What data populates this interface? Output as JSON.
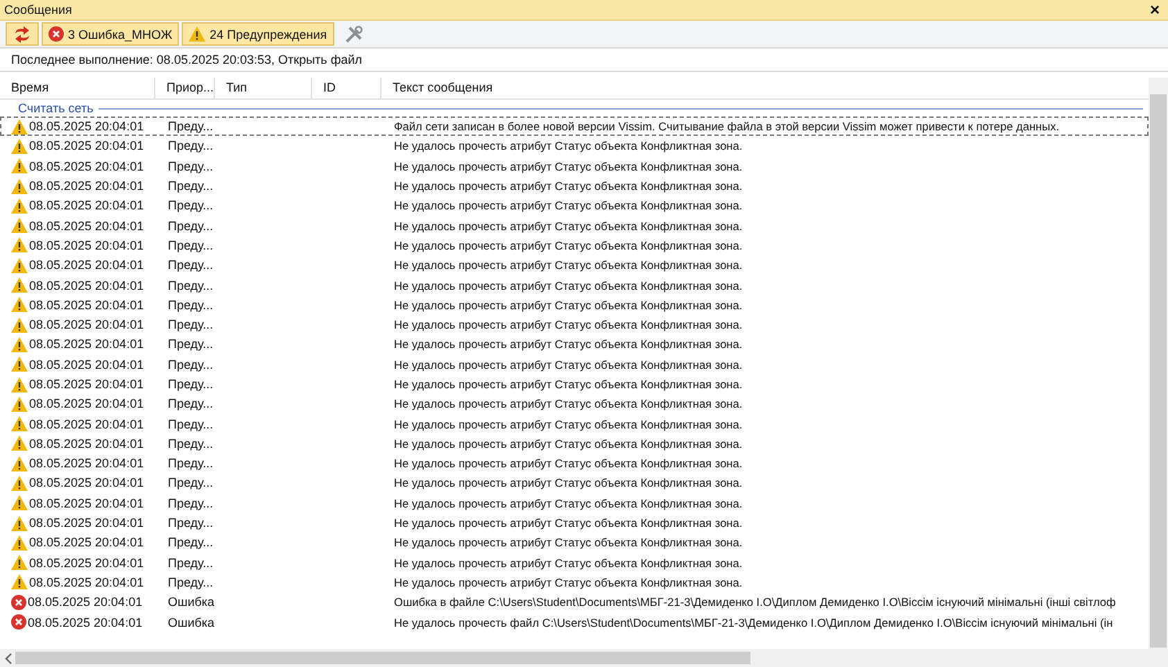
{
  "window": {
    "title": "Сообщения",
    "close": "×"
  },
  "toolbar": [
    {
      "kind": "refresh",
      "selected": true
    },
    {
      "kind": "errors",
      "label": "3 Ошибка_МНОЖ",
      "selected": true
    },
    {
      "kind": "warnings",
      "label": "24 Предупреждения",
      "selected": true
    },
    {
      "kind": "tools",
      "selected": false
    }
  ],
  "last_run": "Последнее выполнение: 08.05.2025 20:03:53, Открыть файл",
  "table": {
    "columns": [
      "Время",
      "Приор...",
      "Тип",
      "ID",
      "Текст сообщения"
    ],
    "group": "Считать сеть",
    "rows": [
      {
        "kind": "warning",
        "focused": true,
        "time": "08.05.2025 20:04:01",
        "priority": "Преду...",
        "text": "Файл сети записан в более новой версии Vissim. Считывание файла в этой версии Vissim может привести к потере данных."
      },
      {
        "kind": "warning",
        "focused": false,
        "time": "08.05.2025 20:04:01",
        "priority": "Преду...",
        "text": "Не удалось прочесть атрибут Статус объекта Конфликтная зона."
      },
      {
        "kind": "warning",
        "focused": false,
        "time": "08.05.2025 20:04:01",
        "priority": "Преду...",
        "text": "Не удалось прочесть атрибут Статус объекта Конфликтная зона."
      },
      {
        "kind": "warning",
        "focused": false,
        "time": "08.05.2025 20:04:01",
        "priority": "Преду...",
        "text": "Не удалось прочесть атрибут Статус объекта Конфликтная зона."
      },
      {
        "kind": "warning",
        "focused": false,
        "time": "08.05.2025 20:04:01",
        "priority": "Преду...",
        "text": "Не удалось прочесть атрибут Статус объекта Конфликтная зона."
      },
      {
        "kind": "warning",
        "focused": false,
        "time": "08.05.2025 20:04:01",
        "priority": "Преду...",
        "text": "Не удалось прочесть атрибут Статус объекта Конфликтная зона."
      },
      {
        "kind": "warning",
        "focused": false,
        "time": "08.05.2025 20:04:01",
        "priority": "Преду...",
        "text": "Не удалось прочесть атрибут Статус объекта Конфликтная зона."
      },
      {
        "kind": "warning",
        "focused": false,
        "time": "08.05.2025 20:04:01",
        "priority": "Преду...",
        "text": "Не удалось прочесть атрибут Статус объекта Конфликтная зона."
      },
      {
        "kind": "warning",
        "focused": false,
        "time": "08.05.2025 20:04:01",
        "priority": "Преду...",
        "text": "Не удалось прочесть атрибут Статус объекта Конфликтная зона."
      },
      {
        "kind": "warning",
        "focused": false,
        "time": "08.05.2025 20:04:01",
        "priority": "Преду...",
        "text": "Не удалось прочесть атрибут Статус объекта Конфликтная зона."
      },
      {
        "kind": "warning",
        "focused": false,
        "time": "08.05.2025 20:04:01",
        "priority": "Преду...",
        "text": "Не удалось прочесть атрибут Статус объекта Конфликтная зона."
      },
      {
        "kind": "warning",
        "focused": false,
        "time": "08.05.2025 20:04:01",
        "priority": "Преду...",
        "text": "Не удалось прочесть атрибут Статус объекта Конфликтная зона."
      },
      {
        "kind": "warning",
        "focused": false,
        "time": "08.05.2025 20:04:01",
        "priority": "Преду...",
        "text": "Не удалось прочесть атрибут Статус объекта Конфликтная зона."
      },
      {
        "kind": "warning",
        "focused": false,
        "time": "08.05.2025 20:04:01",
        "priority": "Преду...",
        "text": "Не удалось прочесть атрибут Статус объекта Конфликтная зона."
      },
      {
        "kind": "warning",
        "focused": false,
        "time": "08.05.2025 20:04:01",
        "priority": "Преду...",
        "text": "Не удалось прочесть атрибут Статус объекта Конфликтная зона."
      },
      {
        "kind": "warning",
        "focused": false,
        "time": "08.05.2025 20:04:01",
        "priority": "Преду...",
        "text": "Не удалось прочесть атрибут Статус объекта Конфликтная зона."
      },
      {
        "kind": "warning",
        "focused": false,
        "time": "08.05.2025 20:04:01",
        "priority": "Преду...",
        "text": "Не удалось прочесть атрибут Статус объекта Конфликтная зона."
      },
      {
        "kind": "warning",
        "focused": false,
        "time": "08.05.2025 20:04:01",
        "priority": "Преду...",
        "text": "Не удалось прочесть атрибут Статус объекта Конфликтная зона."
      },
      {
        "kind": "warning",
        "focused": false,
        "time": "08.05.2025 20:04:01",
        "priority": "Преду...",
        "text": "Не удалось прочесть атрибут Статус объекта Конфликтная зона."
      },
      {
        "kind": "warning",
        "focused": false,
        "time": "08.05.2025 20:04:01",
        "priority": "Преду...",
        "text": "Не удалось прочесть атрибут Статус объекта Конфликтная зона."
      },
      {
        "kind": "warning",
        "focused": false,
        "time": "08.05.2025 20:04:01",
        "priority": "Преду...",
        "text": "Не удалось прочесть атрибут Статус объекта Конфликтная зона."
      },
      {
        "kind": "warning",
        "focused": false,
        "time": "08.05.2025 20:04:01",
        "priority": "Преду...",
        "text": "Не удалось прочесть атрибут Статус объекта Конфликтная зона."
      },
      {
        "kind": "warning",
        "focused": false,
        "time": "08.05.2025 20:04:01",
        "priority": "Преду...",
        "text": "Не удалось прочесть атрибут Статус объекта Конфликтная зона."
      },
      {
        "kind": "warning",
        "focused": false,
        "time": "08.05.2025 20:04:01",
        "priority": "Преду...",
        "text": "Не удалось прочесть атрибут Статус объекта Конфликтная зона."
      },
      {
        "kind": "error",
        "focused": false,
        "time": "08.05.2025 20:04:01",
        "priority": "Ошибка",
        "text": "Ошибка в файле C:\\Users\\Student\\Documents\\МБГ-21-3\\Демиденко І.О\\Диплом Демиденко І.О\\Віссім існуючий мінімальні (інші світлоф"
      },
      {
        "kind": "error",
        "focused": false,
        "time": "08.05.2025 20:04:01",
        "priority": "Ошибка",
        "text": "Не удалось прочесть файл C:\\Users\\Student\\Documents\\МБГ-21-3\\Демиденко І.О\\Диплом Демиденко І.О\\Віссім існуючий мінімальні (ін"
      }
    ]
  }
}
